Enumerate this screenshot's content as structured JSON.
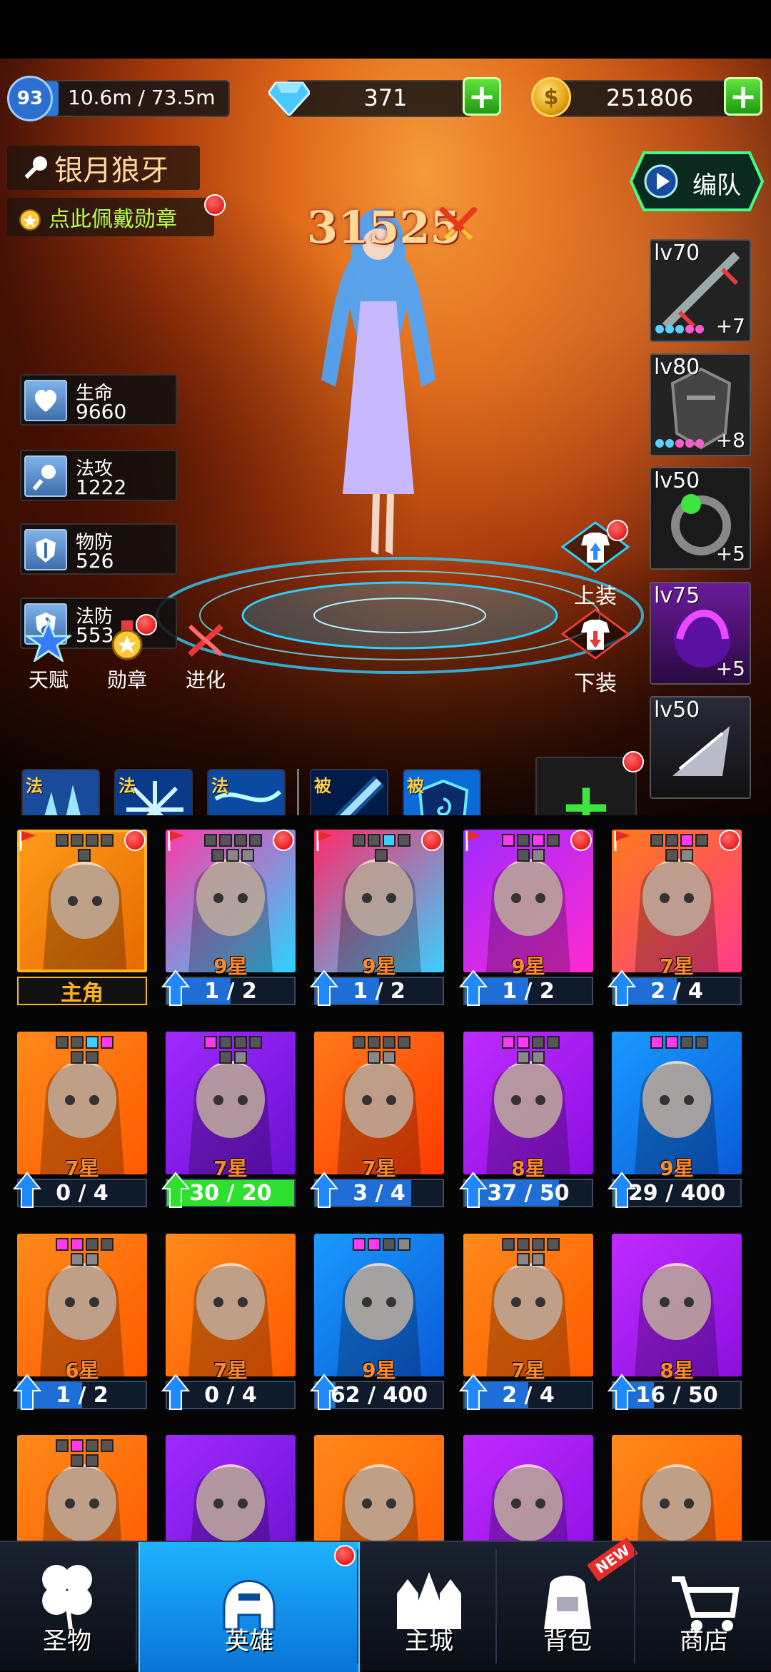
{
  "header": {
    "level": "93",
    "exp_text": "10.6m / 73.5m",
    "exp_progress": 0.144,
    "gems": "371",
    "gold": "251806",
    "gem_plus": "+",
    "gold_plus": "+",
    "coin_symbol": "$"
  },
  "hero": {
    "name": "银月狼牙",
    "medal_prompt": "点此佩戴勋章",
    "power": "31525",
    "team_button": "编队"
  },
  "stats": [
    {
      "label": "生命",
      "value": "9660",
      "icon": "heart-icon"
    },
    {
      "label": "法攻",
      "value": "1222",
      "icon": "magic-wand-icon"
    },
    {
      "label": "物防",
      "value": "526",
      "icon": "sword-shield-icon"
    },
    {
      "label": "法防",
      "value": "553",
      "icon": "magic-shield-icon"
    }
  ],
  "actions": {
    "talent": "天赋",
    "medal": "勋章",
    "evolve": "进化",
    "equip_up": "上装",
    "equip_down": "下装"
  },
  "equipment": [
    {
      "level": "lv70",
      "plus": "+7",
      "dots": [
        "#5ad0ff",
        "#5ad0ff",
        "#5ad0ff",
        "#ff5ad0",
        "#ff5ad0"
      ]
    },
    {
      "level": "lv80",
      "plus": "+8",
      "dots": [
        "#5ad0ff",
        "#5ad0ff",
        "#ff5ad0",
        "#ff5ad0",
        "#ff5ad0"
      ]
    },
    {
      "level": "lv50",
      "plus": "+5",
      "dots": []
    },
    {
      "level": "lv75",
      "plus": "+5",
      "dots": []
    },
    {
      "level": "lv50",
      "plus": "",
      "dots": []
    }
  ],
  "skills": [
    {
      "tag": "法",
      "icon": "ice-crystal-icon"
    },
    {
      "tag": "法",
      "icon": "snowflake-burst-icon"
    },
    {
      "tag": "法",
      "icon": "blizzard-icon"
    },
    {
      "tag": "被",
      "icon": "light-blade-icon"
    },
    {
      "tag": "被",
      "icon": "spiral-shield-icon"
    }
  ],
  "roster": [
    {
      "star": "",
      "progress_text": "主角",
      "progress": 0,
      "main": true,
      "bg": [
        "#ff9a1a",
        "#e86a00"
      ],
      "gems": [
        "#555",
        "#555",
        "#555",
        "#555",
        "#555"
      ]
    },
    {
      "star": "9星",
      "progress_text": "1 / 2",
      "progress": 0.5,
      "bg": [
        "#ff3aa8",
        "#2ad4ff"
      ],
      "gems": [
        "#555",
        "#555",
        "#555",
        "#555",
        "#555",
        "#888",
        "#888"
      ]
    },
    {
      "star": "9星",
      "progress_text": "1 / 2",
      "progress": 0.5,
      "bg": [
        "#ff2a6a",
        "#3ad0ff"
      ],
      "gems": [
        "#555",
        "#555",
        "#3ad0ff",
        "#555",
        "#555"
      ]
    },
    {
      "star": "9星",
      "progress_text": "1 / 2",
      "progress": 0.5,
      "bg": [
        "#a02aff",
        "#ff2ad0"
      ],
      "gems": [
        "#ff3af0",
        "#555",
        "#ff3af0",
        "#555",
        "#555",
        "#888"
      ]
    },
    {
      "star": "7星",
      "progress_text": "2 / 4",
      "progress": 0.5,
      "bg": [
        "#ff7a1a",
        "#ff3a8a"
      ],
      "gems": [
        "#555",
        "#555",
        "#ff3af0",
        "#555",
        "#555",
        "#888"
      ]
    },
    {
      "star": "7星",
      "progress_text": "0 / 4",
      "progress": 0,
      "bg": [
        "#ff8a1a",
        "#ff5a00"
      ],
      "gems": [
        "#555",
        "#555",
        "#3ad0ff",
        "#ff3af0",
        "#555",
        "#555"
      ]
    },
    {
      "star": "7星",
      "progress_text": "30 / 20",
      "progress": 1.0,
      "full": true,
      "bg": [
        "#a02aff",
        "#6a10d0"
      ],
      "gems": [
        "#ff3af0",
        "#555",
        "#555",
        "#555",
        "#555",
        "#888"
      ]
    },
    {
      "star": "7星",
      "progress_text": "3 / 4",
      "progress": 0.75,
      "bg": [
        "#ff7a1a",
        "#ff3a00"
      ],
      "gems": [
        "#555",
        "#555",
        "#555",
        "#555",
        "#888",
        "#888"
      ]
    },
    {
      "star": "8星",
      "progress_text": "37 / 50",
      "progress": 0.74,
      "bg": [
        "#c02aff",
        "#8a10e0"
      ],
      "gems": [
        "#ff3af0",
        "#ff3af0",
        "#555",
        "#555",
        "#888",
        "#888"
      ]
    },
    {
      "star": "9星",
      "progress_text": "29 / 400",
      "progress": 0.0725,
      "bg": [
        "#1a9aff",
        "#0a5ad8"
      ],
      "gems": [
        "#ff3af0",
        "#ff3af0",
        "#555",
        "#555"
      ]
    },
    {
      "star": "6星",
      "progress_text": "1 / 2",
      "progress": 0.5,
      "bg": [
        "#ff8a1a",
        "#ff5a00"
      ],
      "gems": [
        "#ff3af0",
        "#ff3af0",
        "#555",
        "#555",
        "#888",
        "#888"
      ]
    },
    {
      "star": "7星",
      "progress_text": "0 / 4",
      "progress": 0,
      "bg": [
        "#ff8a1a",
        "#ff5a00"
      ],
      "gems": []
    },
    {
      "star": "9星",
      "progress_text": "62 / 400",
      "progress": 0.155,
      "bg": [
        "#1a9aff",
        "#0a5ad8"
      ],
      "gems": [
        "#ff3af0",
        "#ff3af0",
        "#555",
        "#888"
      ]
    },
    {
      "star": "7星",
      "progress_text": "2 / 4",
      "progress": 0.5,
      "bg": [
        "#ff8a1a",
        "#ff5a00"
      ],
      "gems": [
        "#555",
        "#555",
        "#555",
        "#555",
        "#888",
        "#888"
      ]
    },
    {
      "star": "8星",
      "progress_text": "16 / 50",
      "progress": 0.32,
      "bg": [
        "#c02aff",
        "#8a10e0"
      ],
      "gems": []
    },
    {
      "star": "",
      "progress_text": "",
      "progress": 0,
      "bg": [
        "#ff8a1a",
        "#ff5a00"
      ],
      "gems": [
        "#555",
        "#ff3af0",
        "#555",
        "#555",
        "#555",
        "#555"
      ]
    },
    {
      "star": "",
      "progress_text": "",
      "progress": 0,
      "bg": [
        "#a02aff",
        "#6a10d0"
      ],
      "gems": []
    },
    {
      "star": "",
      "progress_text": "",
      "progress": 0,
      "bg": [
        "#ff8a1a",
        "#ff5a00"
      ],
      "gems": []
    },
    {
      "star": "",
      "progress_text": "",
      "progress": 0,
      "bg": [
        "#c02aff",
        "#8a10e0"
      ],
      "gems": []
    },
    {
      "star": "",
      "progress_text": "",
      "progress": 0,
      "bg": [
        "#ff8a1a",
        "#ff5a00"
      ],
      "gems": []
    }
  ],
  "nav": [
    {
      "label": "圣物",
      "icon": "clover-icon"
    },
    {
      "label": "英雄",
      "icon": "helmet-icon",
      "active": true
    },
    {
      "label": "主城",
      "icon": "castle-icon"
    },
    {
      "label": "背包",
      "icon": "backpack-icon",
      "badge": "NEW"
    },
    {
      "label": "商店",
      "icon": "shopping-cart-icon"
    }
  ],
  "colors": {
    "accent": "#1db3ff",
    "plus_green": "#3ce63c",
    "star_orange": "#ff8a2a",
    "medal_text": "#b6ff4a"
  }
}
